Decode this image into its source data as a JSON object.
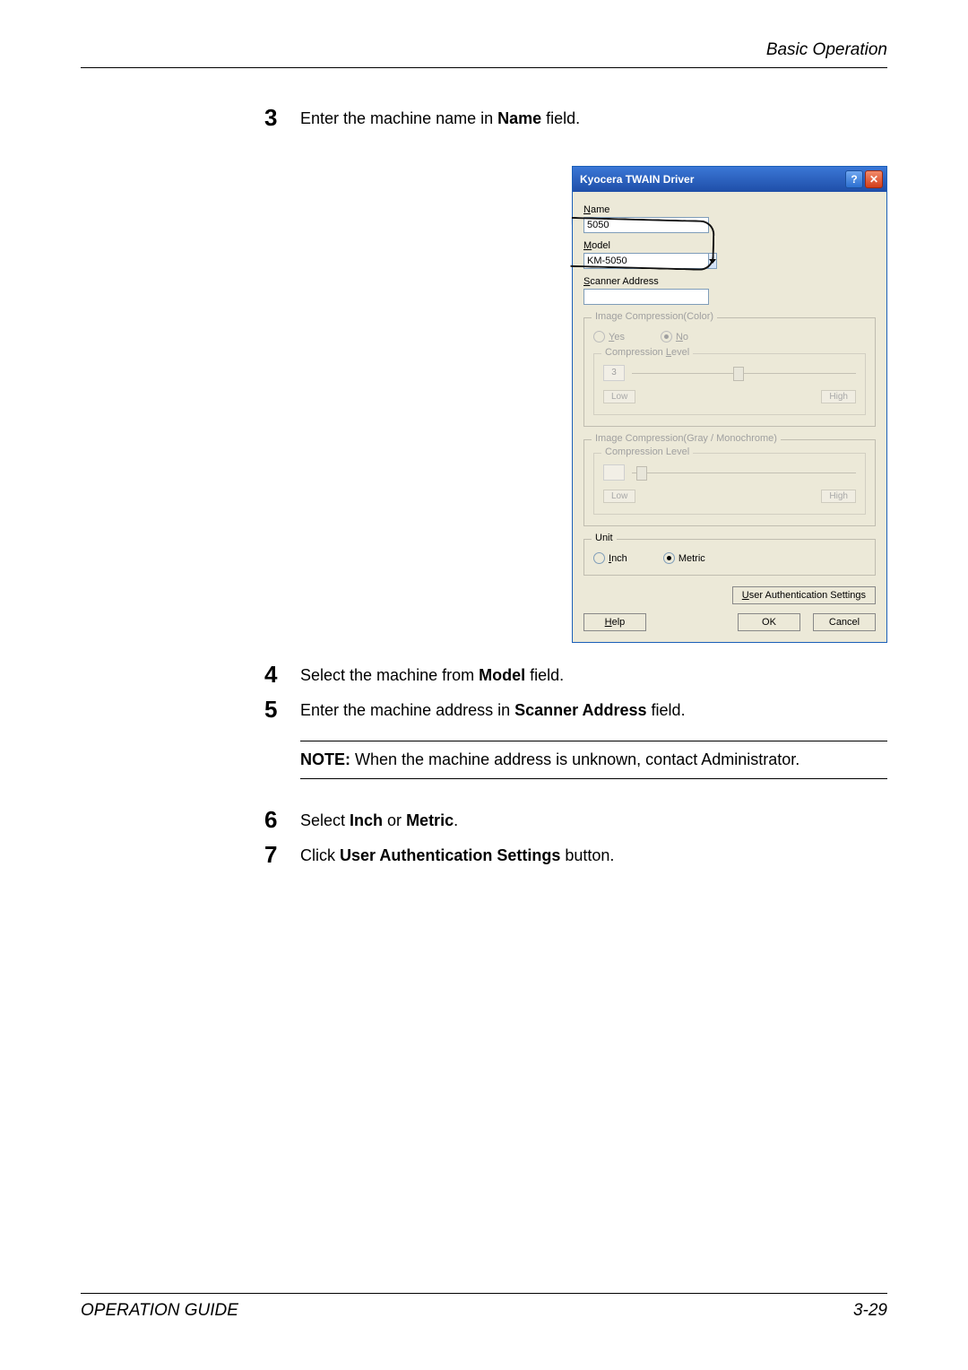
{
  "header": {
    "section": "Basic Operation"
  },
  "steps": {
    "s3": {
      "num": "3",
      "text_a": "Enter the machine name in ",
      "bold": "Name",
      "text_b": " field."
    },
    "s4": {
      "num": "4",
      "text_a": "Select the machine from ",
      "bold": "Model",
      "text_b": " field."
    },
    "s5": {
      "num": "5",
      "text_a": "Enter the machine address in ",
      "bold": "Scanner Address",
      "text_b": " field."
    },
    "s6": {
      "num": "6",
      "text_a": "Select ",
      "bold": "Inch",
      "mid": " or ",
      "bold2": "Metric",
      "text_b": "."
    },
    "s7": {
      "num": "7",
      "text_a": "Click ",
      "bold": "User Authentication Settings",
      "text_b": " button."
    }
  },
  "note": {
    "label": "NOTE:",
    "text": " When the machine address is unknown, contact Administrator."
  },
  "dialog": {
    "title": "Kyocera TWAIN Driver",
    "name_label_pre": "N",
    "name_label_post": "ame",
    "name_value": "5050",
    "model_label_pre": "M",
    "model_label_post": "odel",
    "model_value": "KM-5050",
    "scanner_label_pre": "S",
    "scanner_label_post": "canner Address",
    "scanner_value": "",
    "grp_color": "Image Compression(Color)",
    "yes_pre": "Y",
    "yes_post": "es",
    "no_pre": "N",
    "no_post": "o",
    "comp_level": "Compression Level",
    "comp_level_pre": "Compression ",
    "comp_level_u": "L",
    "comp_level_post": "evel",
    "slider_val": "3",
    "low": "Low",
    "high": "High",
    "grp_gray": "Image Compression(Gray / Monochrome)",
    "unit_label": "Unit",
    "inch_pre": "I",
    "inch_post": "nch",
    "metric_label": "Metric",
    "uas_pre": "U",
    "uas_post": "ser Authentication Settings",
    "help_pre": "H",
    "help_post": "elp",
    "ok": "OK",
    "cancel": "Cancel"
  },
  "footer": {
    "left": "OPERATION GUIDE",
    "right": "3-29"
  }
}
